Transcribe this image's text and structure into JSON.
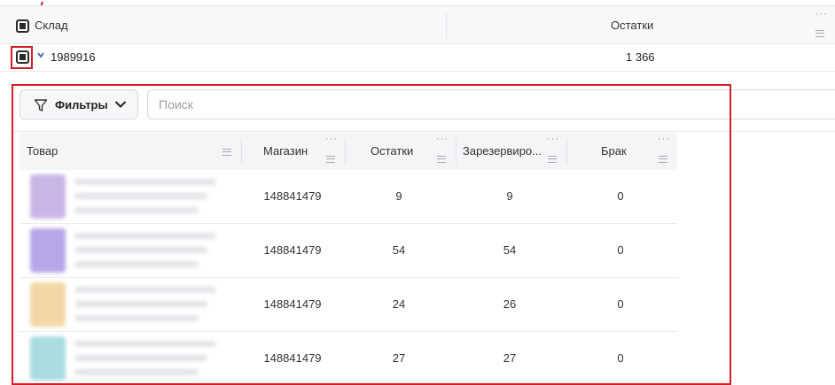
{
  "outer_grid": {
    "col_warehouse": "Склад",
    "col_stock": "Остатки",
    "col_menu_dots": "···",
    "row": {
      "id": "1989916",
      "stock": "1 366"
    }
  },
  "toolbar": {
    "filters_label": "Фильтры",
    "search_placeholder": "Поиск"
  },
  "inner_table": {
    "columns": [
      "Товар",
      "Магазин",
      "Остатки",
      "Зарезервиро...",
      "Брак"
    ],
    "rows": [
      {
        "shop": "148841479",
        "stock": "9",
        "reserved": "9",
        "defect": "0",
        "thumb_color": "#c9b6e6"
      },
      {
        "shop": "148841479",
        "stock": "54",
        "reserved": "54",
        "defect": "0",
        "thumb_color": "#b7a6e8"
      },
      {
        "shop": "148841479",
        "stock": "24",
        "reserved": "26",
        "defect": "0",
        "thumb_color": "#f3d7a6"
      },
      {
        "shop": "148841479",
        "stock": "27",
        "reserved": "27",
        "defect": "0",
        "thumb_color": "#a9dde0"
      }
    ]
  },
  "colors": {
    "highlight": "#d21f26",
    "header_bg": "#f7f8fa"
  }
}
